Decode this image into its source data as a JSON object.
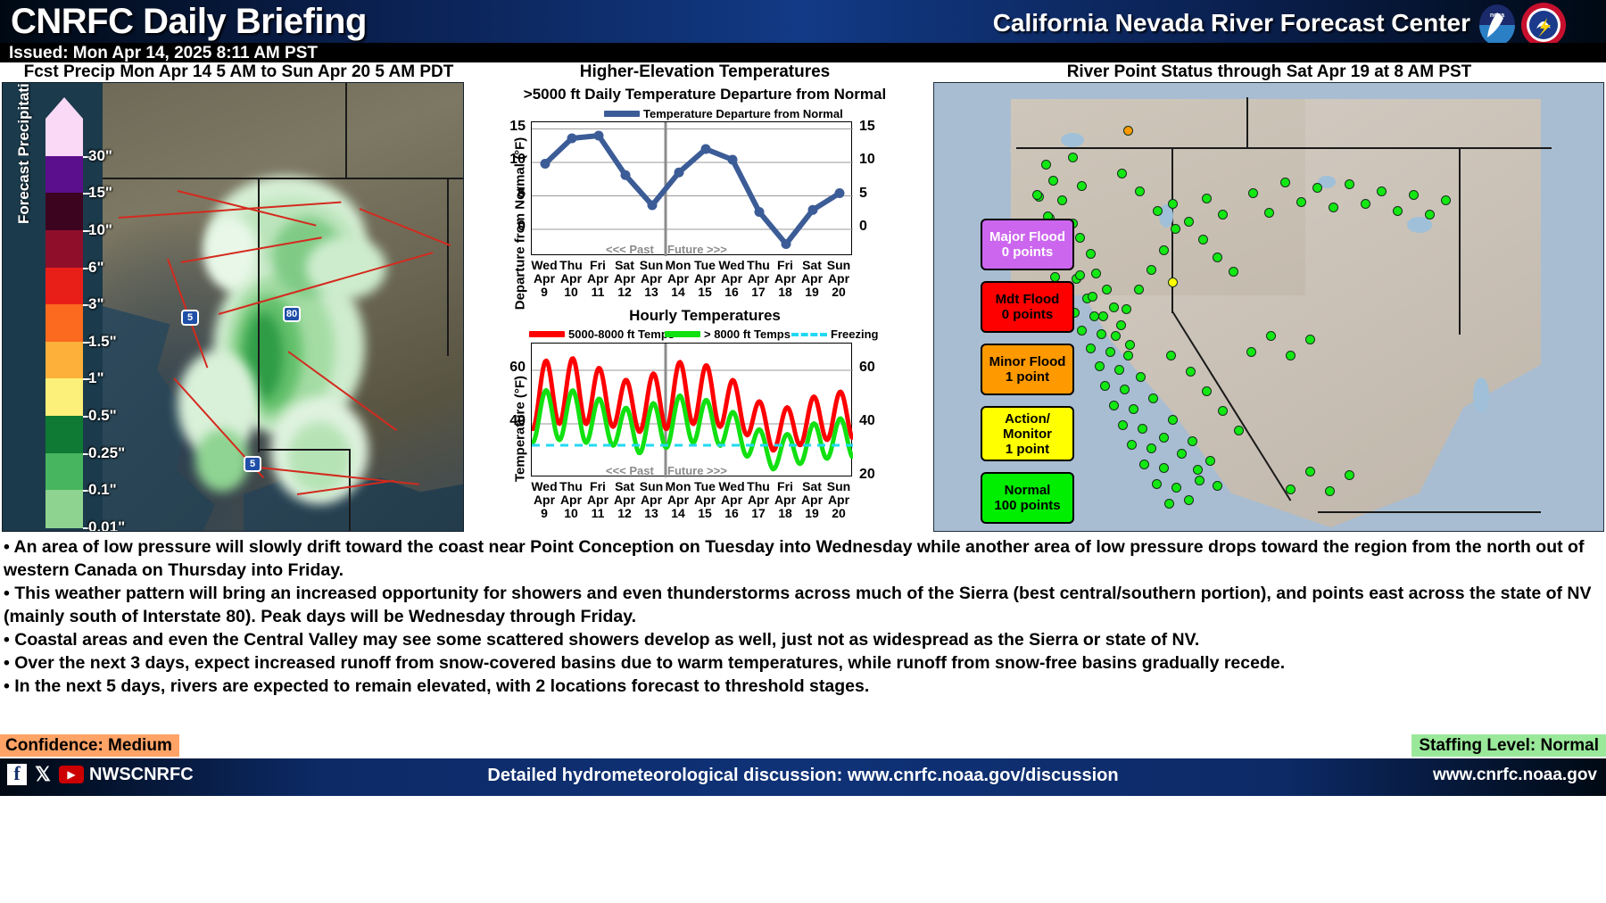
{
  "header": {
    "title": "CNRFC Daily Briefing",
    "org": "California Nevada River Forecast Center",
    "issued": "Issued: Mon Apr 14, 2025 8:11 AM PST",
    "noaa_logo": "noaa-logo",
    "nws_logo": "nws-logo"
  },
  "panels": {
    "precip_title": "Fcst Precip Mon Apr 14 5 AM to Sun Apr 20 5 AM PDT",
    "temps_title": "Higher-Elevation Temperatures",
    "river_title": "River Point Status through Sat Apr 19 at 8 AM PST"
  },
  "precip_legend": {
    "axis_label": "Forecast Precipitation (in)",
    "stops": [
      {
        "label": "30\"",
        "color": "#f9d9f6"
      },
      {
        "label": "15\"",
        "color": "#5b0f8c"
      },
      {
        "label": "10\"",
        "color": "#3d0420"
      },
      {
        "label": "6\"",
        "color": "#8f0f2a"
      },
      {
        "label": "3\"",
        "color": "#e81f18"
      },
      {
        "label": "1.5\"",
        "color": "#fb6a1e"
      },
      {
        "label": "1\"",
        "color": "#fdb03a"
      },
      {
        "label": "0.5\"",
        "color": "#fdf07a"
      },
      {
        "label": "0.25\"",
        "color": "#0f7a33"
      },
      {
        "label": "0.1\"",
        "color": "#47b55f"
      },
      {
        "label": "0.01\"",
        "color": "#8fd391"
      }
    ],
    "bottom_label": "0.01\""
  },
  "chart_data": [
    {
      "type": "line",
      "title": ">5000 ft Daily Temperature Departure from Normal",
      "ylabel": "Departure from Normal (°F)",
      "xlabel": "",
      "legend": [
        "Temperature Departure from Normal"
      ],
      "legend_position": "top-center",
      "series_color": "#3b5c96",
      "grid": true,
      "ylim": [
        -4,
        16
      ],
      "yticks": [
        0,
        5,
        10,
        15
      ],
      "yticks_right": [
        0,
        5,
        10,
        15
      ],
      "categories": [
        "Wed Apr 9",
        "Thu Apr 10",
        "Fri Apr 11",
        "Sat Apr 12",
        "Sun Apr 13",
        "Mon Apr 14",
        "Tue Apr 15",
        "Wed Apr 16",
        "Thu Apr 17",
        "Fri Apr 18",
        "Sat Apr 19",
        "Sun Apr 20"
      ],
      "day_labels": [
        "Wed",
        "Thu",
        "Fri",
        "Sat",
        "Sun",
        "Mon",
        "Tue",
        "Wed",
        "Thu",
        "Fri",
        "Sat",
        "Sun"
      ],
      "month_labels": [
        "Apr",
        "Apr",
        "Apr",
        "Apr",
        "Apr",
        "Apr",
        "Apr",
        "Apr",
        "Apr",
        "Apr",
        "Apr",
        "Apr"
      ],
      "date_labels": [
        "9",
        "10",
        "11",
        "12",
        "13",
        "14",
        "15",
        "16",
        "17",
        "18",
        "19",
        "20"
      ],
      "values": [
        9.8,
        13.6,
        14.0,
        8.1,
        3.6,
        8.5,
        12.0,
        10.4,
        2.6,
        -2.2,
        2.9,
        5.4
      ],
      "now_index": 5,
      "past_label": "<<< Past",
      "future_label": "Future >>>"
    },
    {
      "type": "line",
      "title": "Hourly Temperatures",
      "ylabel": "Temperature (°F)",
      "xlabel": "",
      "legend": [
        "5000-8000 ft Temps",
        "> 8000 ft Temps",
        "Freezing"
      ],
      "legend_position": "top",
      "grid": true,
      "ylim": [
        20,
        70
      ],
      "yticks": [
        40,
        60
      ],
      "yticks_right": [
        20,
        40,
        60
      ],
      "freezing_level": 32,
      "series": [
        {
          "name": "5000-8000 ft Temps",
          "color": "#ff0000",
          "daily_max": [
            62,
            65,
            64,
            58,
            55,
            62,
            64,
            60,
            53,
            44,
            48,
            52
          ],
          "daily_min": [
            38,
            40,
            40,
            39,
            37,
            38,
            40,
            39,
            36,
            30,
            32,
            34
          ]
        },
        {
          "name": "> 8000 ft Temps",
          "color": "#11e011",
          "daily_max": [
            52,
            53,
            52,
            47,
            45,
            50,
            51,
            47,
            42,
            34,
            38,
            42
          ],
          "daily_min": [
            33,
            34,
            33,
            32,
            29,
            31,
            33,
            32,
            28,
            23,
            25,
            27
          ]
        }
      ],
      "freezing_color": "#22d8f2",
      "categories": [
        "Wed Apr 9",
        "Thu Apr 10",
        "Fri Apr 11",
        "Sat Apr 12",
        "Sun Apr 13",
        "Mon Apr 14",
        "Tue Apr 15",
        "Wed Apr 16",
        "Thu Apr 17",
        "Fri Apr 18",
        "Sat Apr 19",
        "Sun Apr 20"
      ],
      "day_labels": [
        "Wed",
        "Thu",
        "Fri",
        "Sat",
        "Sun",
        "Mon",
        "Tue",
        "Wed",
        "Thu",
        "Fri",
        "Sat",
        "Sun"
      ],
      "month_labels": [
        "Apr",
        "Apr",
        "Apr",
        "Apr",
        "Apr",
        "Apr",
        "Apr",
        "Apr",
        "Apr",
        "Apr",
        "Apr",
        "Apr"
      ],
      "date_labels": [
        "9",
        "10",
        "11",
        "12",
        "13",
        "14",
        "15",
        "16",
        "17",
        "18",
        "19",
        "20"
      ],
      "now_index": 5,
      "past_label": "<<< Past",
      "future_label": "Future >>>"
    }
  ],
  "river_legend": [
    {
      "name": "Major Flood",
      "points": "0 points",
      "color": "#cc66ee",
      "text_color": "#ffffff"
    },
    {
      "name": "Mdt Flood",
      "points": "0 points",
      "color": "#ff0000",
      "text_color": "#000000"
    },
    {
      "name": "Minor Flood",
      "points": "1 point",
      "color": "#ff9900",
      "text_color": "#000000"
    },
    {
      "name": "Action/\nMonitor",
      "points": "1 point",
      "color": "#ffff00",
      "text_color": "#000000"
    },
    {
      "name": "Normal",
      "points": "100 points",
      "color": "#00ee00",
      "text_color": "#000000"
    }
  ],
  "river_legend_labels": {
    "major_name": "Major Flood",
    "major_points": "0 points",
    "mdt_name": "Mdt Flood",
    "mdt_points": "0 points",
    "minor_name": "Minor Flood",
    "minor_points": "1 point",
    "action_name1": "Action/",
    "action_name2": "Monitor",
    "action_points": "1 point",
    "normal_name": "Normal",
    "normal_points": "100 points"
  },
  "bullets": [
    "• An area of low pressure will slowly drift toward the coast near Point Conception on Tuesday into Wednesday while another area of low pressure drops toward the region from the north out of western Canada on Thursday into Friday.",
    "• This weather pattern will bring an increased opportunity for showers and even thunderstorms across much of the Sierra (best central/southern portion), and points east across the state of NV (mainly south of Interstate 80). Peak days will be Wednesday through Friday.",
    "• Coastal areas and even the Central Valley may see some scattered showers develop as well, just not as widespread as the Sierra or state of NV.",
    "• Over the next 3 days, expect increased runoff from snow-covered basins due to warm temperatures, while runoff from snow-free basins gradually recede.",
    "• In the next 5 days, rivers are expected to remain elevated, with 2 locations forecast to threshold stages."
  ],
  "status": {
    "confidence": "Confidence: Medium",
    "staffing": "Staffing Level: Normal"
  },
  "footer": {
    "social_handle": "NWSCNRFC",
    "facebook_icon": "facebook-icon",
    "x_icon": "x-twitter-icon",
    "youtube_icon": "youtube-icon",
    "center_text": "Detailed hydrometeorological discussion: www.cnrfc.noaa.gov/discussion",
    "right_text": "www.cnrfc.noaa.gov"
  },
  "colors": {
    "header_blue": "#0f3277",
    "confidence_bg": "#ffa366",
    "staffing_bg": "#9ae89a",
    "departure_line": "#3b5c96"
  }
}
